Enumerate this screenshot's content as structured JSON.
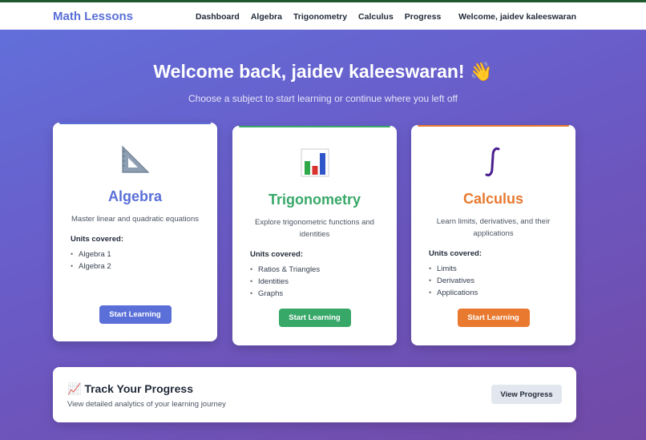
{
  "nav": {
    "brand": "Math Lessons",
    "links": [
      "Dashboard",
      "Algebra",
      "Trigonometry",
      "Calculus",
      "Progress"
    ],
    "welcome": "Welcome, jaidev kaleeswaran"
  },
  "hero": {
    "title": "Welcome back, jaidev kaleeswaran! 👋",
    "subtitle": "Choose a subject to start learning or continue where you left off"
  },
  "cards": [
    {
      "title": "Algebra",
      "icon": "triangle-ruler-icon",
      "description": "Master linear and quadratic equations",
      "units_title": "Units covered:",
      "units": [
        "Algebra 1",
        "Algebra 2"
      ],
      "button": "Start Learning",
      "color": "#5a6fd8"
    },
    {
      "title": "Trigonometry",
      "icon": "bar-chart-icon",
      "description": "Explore trigonometric functions and identities",
      "units_title": "Units covered:",
      "units": [
        "Ratios & Triangles",
        "Identities",
        "Graphs"
      ],
      "button": "Start Learning",
      "color": "#38a869"
    },
    {
      "title": "Calculus",
      "icon": "integral-icon",
      "description": "Learn limits, derivatives, and their applications",
      "units_title": "Units covered:",
      "units": [
        "Limits",
        "Derivatives",
        "Applications"
      ],
      "button": "Start Learning",
      "color": "#e8792f"
    }
  ],
  "progress": {
    "title": "📈 Track Your Progress",
    "subtitle": "View detailed analytics of your learning journey",
    "button": "View Progress"
  }
}
